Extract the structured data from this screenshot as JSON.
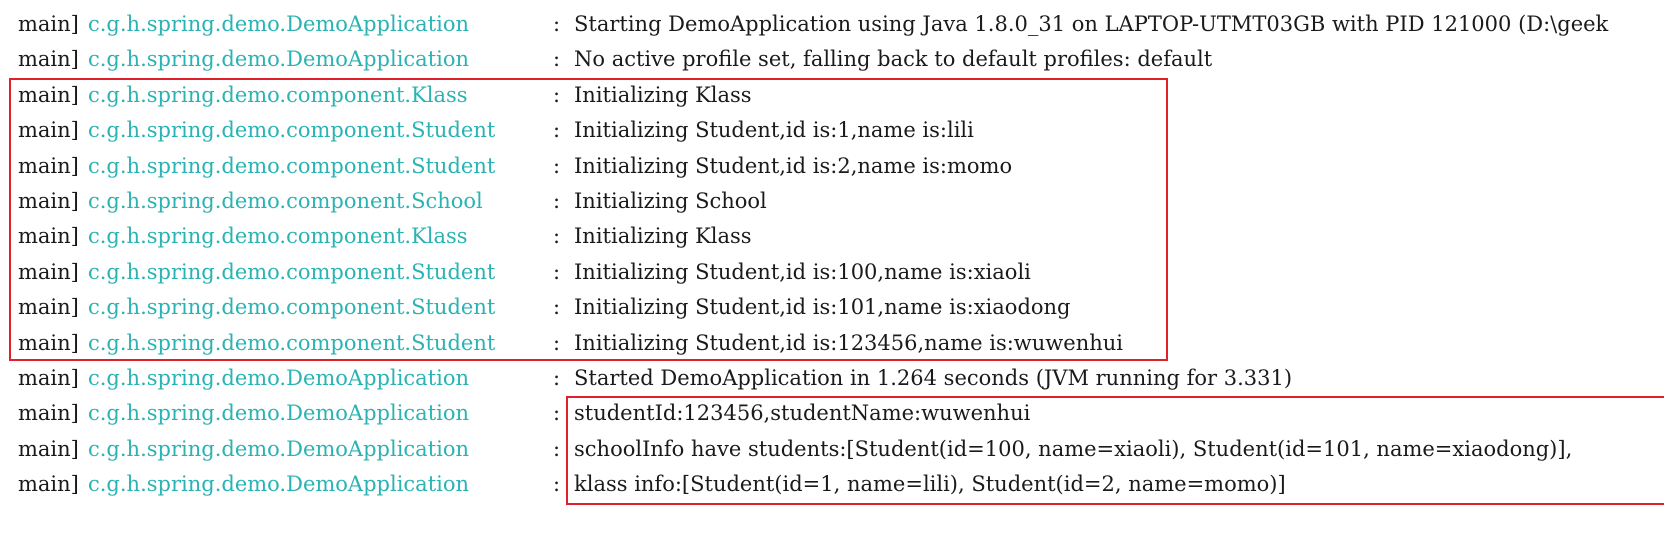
{
  "console": {
    "lines": [
      {
        "thread": "main]",
        "logger": "c.g.h.spring.demo.DemoApplication",
        "sep": ":",
        "message": "Starting DemoApplication using Java 1.8.0_31 on LAPTOP-UTMT03GB with PID 121000 (D:\\geek"
      },
      {
        "thread": "main]",
        "logger": "c.g.h.spring.demo.DemoApplication",
        "sep": ":",
        "message": "No active profile set, falling back to default profiles: default"
      },
      {
        "thread": "main]",
        "logger": "c.g.h.spring.demo.component.Klass",
        "sep": ":",
        "message": "Initializing Klass"
      },
      {
        "thread": "main]",
        "logger": "c.g.h.spring.demo.component.Student",
        "sep": ":",
        "message": "Initializing Student,id is:1,name is:lili"
      },
      {
        "thread": "main]",
        "logger": "c.g.h.spring.demo.component.Student",
        "sep": ":",
        "message": "Initializing Student,id is:2,name is:momo"
      },
      {
        "thread": "main]",
        "logger": "c.g.h.spring.demo.component.School",
        "sep": ":",
        "message": "Initializing School"
      },
      {
        "thread": "main]",
        "logger": "c.g.h.spring.demo.component.Klass",
        "sep": ":",
        "message": "Initializing Klass"
      },
      {
        "thread": "main]",
        "logger": "c.g.h.spring.demo.component.Student",
        "sep": ":",
        "message": "Initializing Student,id is:100,name is:xiaoli"
      },
      {
        "thread": "main]",
        "logger": "c.g.h.spring.demo.component.Student",
        "sep": ":",
        "message": "Initializing Student,id is:101,name is:xiaodong"
      },
      {
        "thread": "main]",
        "logger": "c.g.h.spring.demo.component.Student",
        "sep": ":",
        "message": "Initializing Student,id is:123456,name is:wuwenhui"
      },
      {
        "thread": "main]",
        "logger": "c.g.h.spring.demo.DemoApplication",
        "sep": ":",
        "message": "Started DemoApplication in 1.264 seconds (JVM running for 3.331)"
      },
      {
        "thread": "main]",
        "logger": "c.g.h.spring.demo.DemoApplication",
        "sep": ":",
        "message": "studentId:123456,studentName:wuwenhui"
      },
      {
        "thread": "main]",
        "logger": "c.g.h.spring.demo.DemoApplication",
        "sep": ":",
        "message": "schoolInfo have students:[Student(id=100, name=xiaoli), Student(id=101, name=xiaodong)],"
      },
      {
        "thread": "main]",
        "logger": "c.g.h.spring.demo.DemoApplication",
        "sep": ":",
        "message": "klass info:[Student(id=1, name=lili), Student(id=2, name=momo)]"
      }
    ]
  },
  "colors": {
    "logger": "#2bb3b3",
    "text": "#1a1a1a",
    "highlight": "#e0202a",
    "background": "#ffffff"
  }
}
